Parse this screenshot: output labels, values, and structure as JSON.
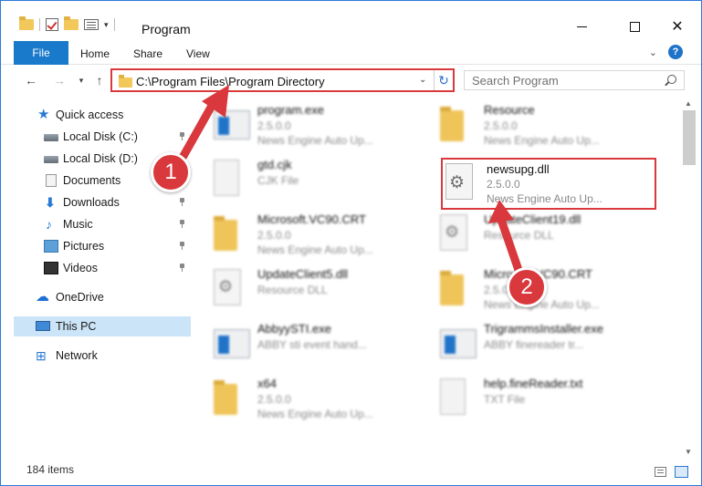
{
  "window": {
    "title": "Program"
  },
  "ribbon": {
    "tabs": [
      "File",
      "Home",
      "Share",
      "View"
    ],
    "help": "?"
  },
  "address": {
    "path": "C:\\Program Files\\Program Directory"
  },
  "search": {
    "placeholder": "Search Program"
  },
  "sidebar": {
    "items": [
      {
        "label": "Quick access",
        "icon": "star-icon"
      },
      {
        "label": "Local Disk (C:)",
        "icon": "disk-icon",
        "pinned": true
      },
      {
        "label": "Local Disk (D:)",
        "icon": "disk-icon",
        "pinned": true
      },
      {
        "label": "Documents",
        "icon": "documents-icon",
        "pinned": true
      },
      {
        "label": "Downloads",
        "icon": "download-icon",
        "pinned": true
      },
      {
        "label": "Music",
        "icon": "music-icon",
        "pinned": true
      },
      {
        "label": "Pictures",
        "icon": "pictures-icon",
        "pinned": true
      },
      {
        "label": "Videos",
        "icon": "video-icon",
        "pinned": true
      },
      {
        "label": "OneDrive",
        "icon": "cloud-icon"
      },
      {
        "label": "This PC",
        "icon": "computer-icon",
        "selected": true
      },
      {
        "label": "Network",
        "icon": "network-icon"
      }
    ]
  },
  "files": [
    {
      "name": "program.exe",
      "version": "2.5.0.0",
      "desc": "News Engine Auto Up...",
      "kind": "exe"
    },
    {
      "name": "Resource",
      "version": "2.5.0.0",
      "desc": "News Engine Auto Up...",
      "kind": "folder"
    },
    {
      "name": "gtd.cjk",
      "version": "CJK File",
      "desc": "",
      "kind": "doc"
    },
    {
      "name": "Microsoft.VC90.CRT",
      "version": "2.5.0.0",
      "desc": "News Engine Auto Up...",
      "kind": "folder"
    },
    {
      "name": "UpdateClient19.dll",
      "version": "Resource DLL",
      "desc": "",
      "kind": "dll"
    },
    {
      "name": "UpdateClient5.dll",
      "version": "Resource DLL",
      "desc": "",
      "kind": "dll"
    },
    {
      "name": "Microsoft.VC90.CRT",
      "version": "2.5.0.0",
      "desc": "News Engine Auto Up...",
      "kind": "folder"
    },
    {
      "name": "AbbyySTI.exe",
      "version": "ABBY sti event hand...",
      "desc": "",
      "kind": "exe"
    },
    {
      "name": "TrigrammsInstaller.exe",
      "version": "ABBY finereader tr...",
      "desc": "",
      "kind": "exe"
    },
    {
      "name": "x64",
      "version": "2.5.0.0",
      "desc": "News Engine Auto Up...",
      "kind": "folder"
    },
    {
      "name": "help.fineReader.txt",
      "version": "TXT File",
      "desc": "",
      "kind": "doc"
    }
  ],
  "highlighted_file": {
    "name": "newsupg.dll",
    "version": "2.5.0.0",
    "desc": "News Engine Auto Up..."
  },
  "status": {
    "count": "184 items"
  },
  "callouts": [
    "1",
    "2"
  ],
  "colors": {
    "accent": "#1979ca",
    "highlight": "#d9383c",
    "selected": "#cce4f7"
  }
}
